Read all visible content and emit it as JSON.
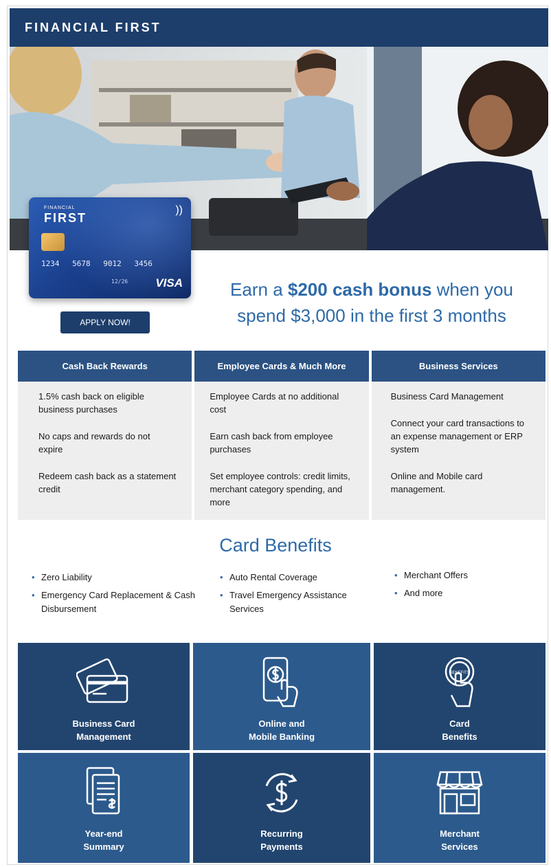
{
  "header": {
    "brand": "FINANCIAL FIRST"
  },
  "card": {
    "brand_small": "FINANCIAL",
    "brand": "FIRST",
    "number": "1234 5678 9012 3456",
    "expiry": "12/26",
    "network": "VISA"
  },
  "cta": {
    "apply_label": "APPLY NOW!"
  },
  "promo": {
    "line1_pre": "Earn a ",
    "line1_bold": "$200 cash bonus",
    "line1_post": " when you",
    "line2": "spend $3,000 in the first 3 months"
  },
  "columns": [
    {
      "title": "Cash Back Rewards",
      "items": [
        "1.5% cash back on eligible business purchases",
        "No caps and rewards do not expire",
        "Redeem cash back as a statement credit"
      ]
    },
    {
      "title": "Employee Cards & Much More",
      "items": [
        "Employee Cards at no additional cost",
        "Earn cash back from employee purchases",
        "Set employee controls: credit limits, merchant category spending, and more"
      ]
    },
    {
      "title": "Business Services",
      "items": [
        "Business Card Management",
        "Connect your card transactions to an expense management or ERP system",
        "Online and Mobile card management."
      ]
    }
  ],
  "benefits": {
    "title": "Card Benefits",
    "col1": [
      "Zero Liability",
      "Emergency Card Replacement & Cash Disbursement"
    ],
    "col2": [
      "Auto Rental Coverage",
      "Travel Emergency Assistance Services"
    ],
    "col3": [
      "Merchant Offers",
      "And more"
    ]
  },
  "tiles": [
    {
      "label": "Business Card\nManagement",
      "icon": "credit-cards-icon"
    },
    {
      "label": "Online and\nMobile Banking",
      "icon": "mobile-payment-icon"
    },
    {
      "label": "Card\nBenefits",
      "icon": "benefits-touch-icon"
    },
    {
      "label": "Year-end\nSummary",
      "icon": "document-summary-icon"
    },
    {
      "label": "Recurring\nPayments",
      "icon": "recurring-dollar-icon"
    },
    {
      "label": "Merchant\nServices",
      "icon": "storefront-icon"
    }
  ],
  "colors": {
    "navy": "#1d3e6b",
    "accent_blue": "#2e6aa8",
    "tile_dark": "#22456f",
    "tile_light": "#2c5a8c"
  }
}
